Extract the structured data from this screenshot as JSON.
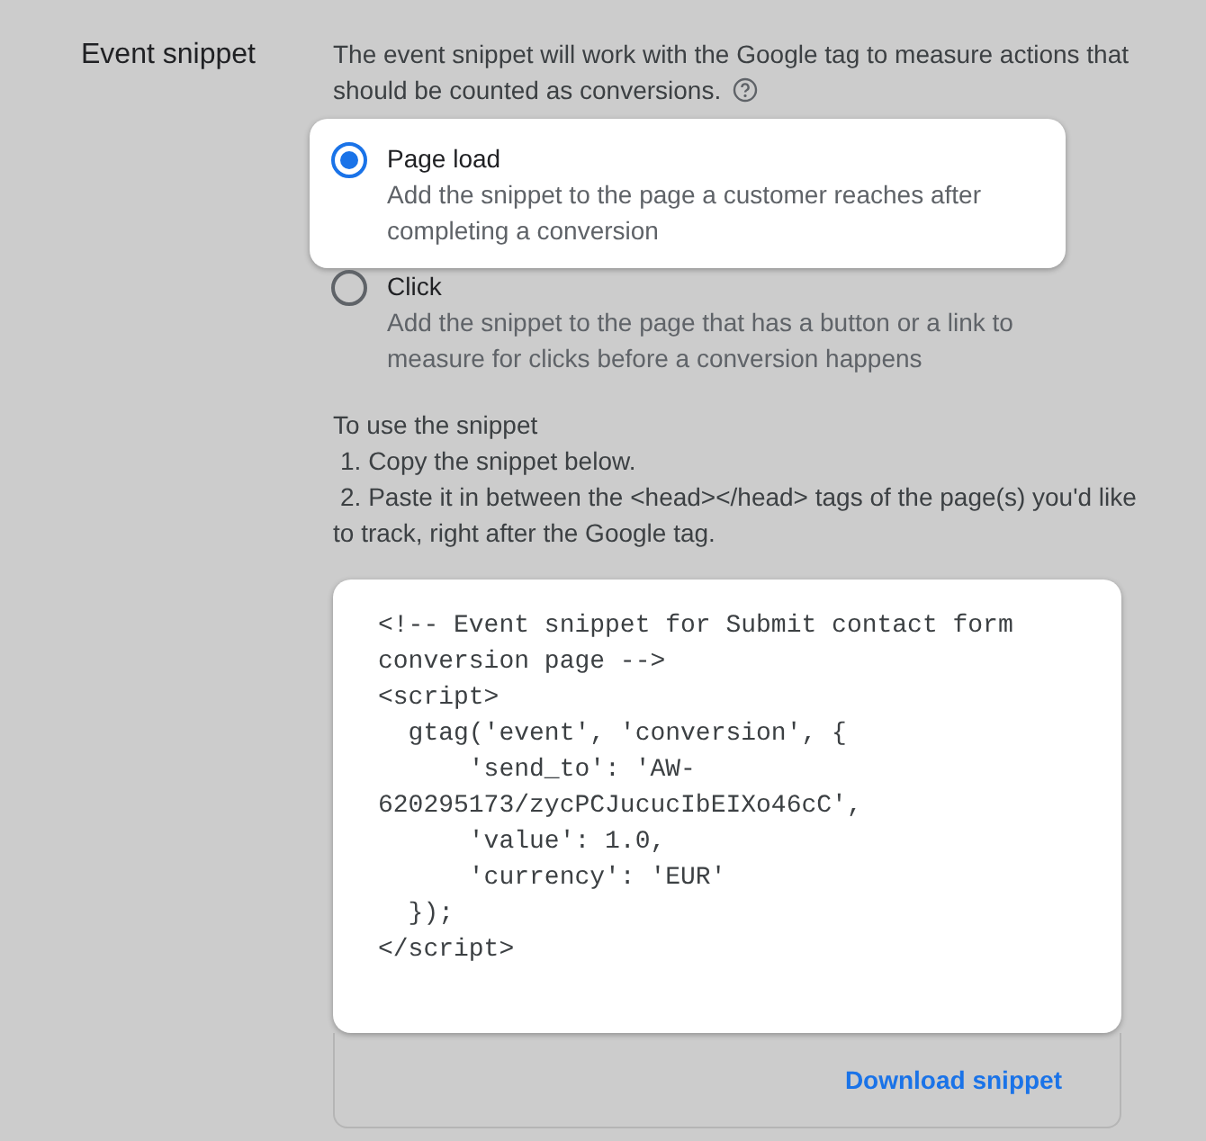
{
  "section": {
    "title": "Event snippet",
    "description": "The event snippet will work with the Google tag to measure actions that should be counted as conversions.",
    "options": [
      {
        "label": "Page load",
        "description": "Add the snippet to the page a customer reaches after completing a conversion",
        "selected": true
      },
      {
        "label": "Click",
        "description": "Add the snippet to the page that has a button or a link to measure for clicks before a conversion happens",
        "selected": false
      }
    ],
    "instructions_title": "To use the snippet",
    "instructions": [
      "1. Copy the snippet below.",
      "2. Paste it in between the <head></head> tags of the page(s) you'd like to track, right after the Google tag."
    ],
    "code_lines": [
      "<!-- Event snippet for Submit contact form",
      "conversion page -->",
      "<script>",
      "  gtag('event', 'conversion', {",
      "      'send_to': 'AW-",
      "620295173/zycPCJucucIbEIXo46cC',",
      "      'value': 1.0,",
      "      'currency': 'EUR'",
      "  });",
      "</script>"
    ],
    "download_link": "Download snippet"
  }
}
